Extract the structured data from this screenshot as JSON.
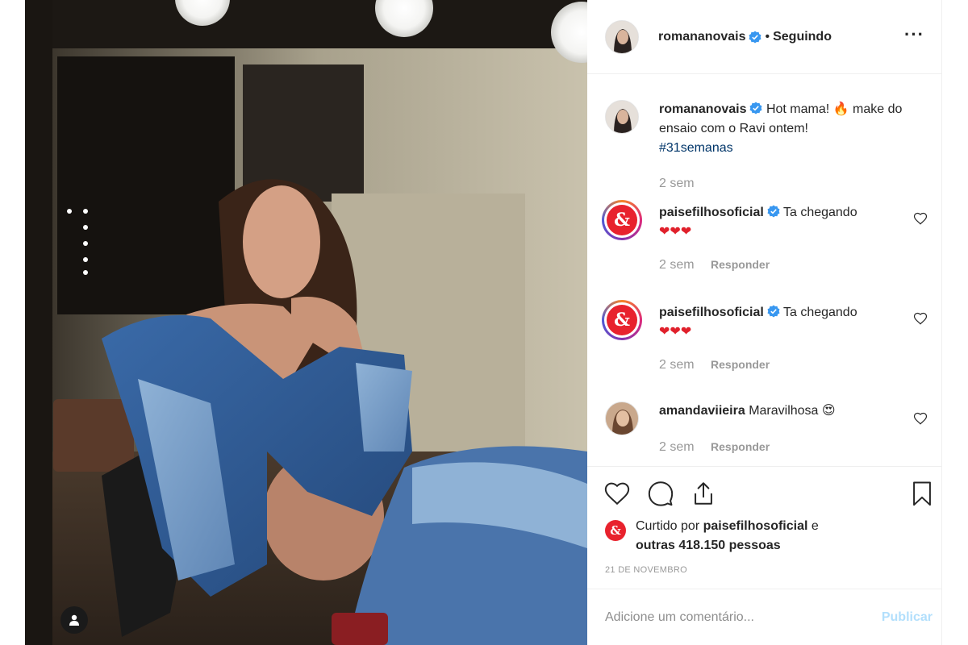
{
  "post": {
    "username": "romananovais",
    "follow_status": "Seguindo",
    "dot": "•",
    "more": "···"
  },
  "caption": {
    "username": "romananovais",
    "text": "Hot mama! 🔥 make do ensaio com o Ravi ontem!",
    "hashtag": "#31semanas",
    "time": "2 sem"
  },
  "comments": [
    {
      "username": "paisefilhosoficial",
      "text": "Ta chegando",
      "emojis": "❤❤❤",
      "time": "2 sem",
      "reply": "Responder"
    },
    {
      "username": "paisefilhosoficial",
      "text": "Ta chegando",
      "emojis": "❤❤❤",
      "time": "2 sem",
      "reply": "Responder"
    },
    {
      "username": "amandaviieira",
      "text": "Maravilhosa 😍",
      "time": "2 sem",
      "reply": "Responder"
    }
  ],
  "likes": {
    "prefix": "Curtido por",
    "user": "paisefilhosoficial",
    "connector": "e",
    "others": "outras 418.150 pessoas"
  },
  "date": "21 DE NOVEMBRO",
  "comment_box": {
    "placeholder": "Adicione um comentário...",
    "publish": "Publicar"
  },
  "brand_logo": "&",
  "colors": {
    "link": "#003569",
    "muted": "#999999",
    "publish_disabled": "#b2dffc",
    "verified": "#3897f0",
    "heart": "#e0202b",
    "brand_red": "#e8222d"
  },
  "icons": [
    "verified-badge-icon",
    "heart-icon",
    "comment-icon",
    "share-icon",
    "bookmark-icon",
    "user-tag-icon",
    "more-options-icon"
  ]
}
